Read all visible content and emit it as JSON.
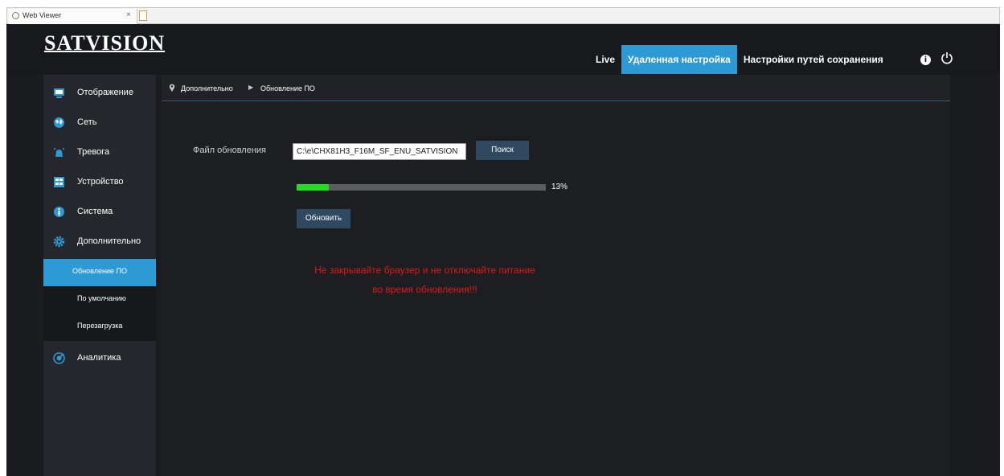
{
  "browser": {
    "tab_title": "Web Viewer",
    "tab_close": "×"
  },
  "header": {
    "logo": "SATVISION",
    "nav": [
      {
        "label": "Live",
        "active": false
      },
      {
        "label": "Удаленная настройка",
        "active": true
      },
      {
        "label": "Настройки путей сохранения",
        "active": false
      }
    ],
    "info_icon": "i"
  },
  "sidebar": {
    "items": [
      {
        "label": "Отображение",
        "icon": "monitor-icon"
      },
      {
        "label": "Сеть",
        "icon": "globe-icon"
      },
      {
        "label": "Тревога",
        "icon": "alarm-bell-icon"
      },
      {
        "label": "Устройство",
        "icon": "device-icon"
      },
      {
        "label": "Система",
        "icon": "info-circle-icon"
      },
      {
        "label": "Дополнительно",
        "icon": "gear-icon"
      },
      {
        "label": "Аналитика",
        "icon": "analytics-icon"
      }
    ],
    "subitems": [
      {
        "label": "Обновление ПО",
        "active": true
      },
      {
        "label": "По умолчанию",
        "active": false
      },
      {
        "label": "Перезагрузка",
        "active": false
      }
    ]
  },
  "breadcrumb": {
    "parent": "Дополнительно",
    "arrow": "▶",
    "current": "Обновление ПО"
  },
  "upgrade": {
    "file_label": "Файл обновления",
    "file_value": "C:\\e\\CHX81H3_F16M_SF_ENU_SATVISION",
    "browse_label": "Поиск",
    "progress_percent": 13,
    "progress_text": "13%",
    "update_label": "Обновить",
    "warning_line1": "Не закрывайте браузер и не отключайте питание",
    "warning_line2": "во время обновления!!!"
  },
  "colors": {
    "accent": "#2d9ad6",
    "progress": "#22dd22",
    "warning": "#e11818",
    "button": "#2e4960"
  }
}
